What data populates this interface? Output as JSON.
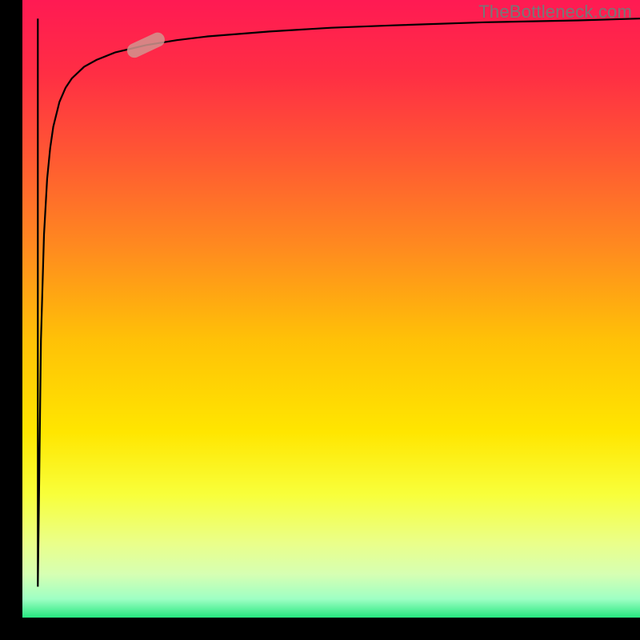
{
  "watermark": "TheBottleneck.com",
  "axes": {
    "left_border_width": 28,
    "bottom_border_height": 28
  },
  "gradient": {
    "stops": [
      {
        "offset": 0.0,
        "color": "#ff1a53"
      },
      {
        "offset": 0.12,
        "color": "#ff2e44"
      },
      {
        "offset": 0.25,
        "color": "#ff5733"
      },
      {
        "offset": 0.4,
        "color": "#ff8a1f"
      },
      {
        "offset": 0.55,
        "color": "#ffc107"
      },
      {
        "offset": 0.7,
        "color": "#ffe600"
      },
      {
        "offset": 0.8,
        "color": "#f8ff3a"
      },
      {
        "offset": 0.88,
        "color": "#eaff8a"
      },
      {
        "offset": 0.93,
        "color": "#d6ffb3"
      },
      {
        "offset": 0.97,
        "color": "#9effc4"
      },
      {
        "offset": 1.0,
        "color": "#26e87f"
      }
    ]
  },
  "chart_data": {
    "type": "line",
    "title": "",
    "xlabel": "",
    "ylabel": "",
    "xlim": [
      0,
      100
    ],
    "ylim": [
      0,
      100
    ],
    "series": [
      {
        "name": "curve",
        "x": [
          2.5,
          2.7,
          3.0,
          3.5,
          4.0,
          4.5,
          5.0,
          6.0,
          7.0,
          8.0,
          10.0,
          12.0,
          15.0,
          20.0,
          25.0,
          30.0,
          40.0,
          50.0,
          60.0,
          75.0,
          90.0,
          100.0
        ],
        "y": [
          5.0,
          20.0,
          45.0,
          62.0,
          71.0,
          76.0,
          79.5,
          83.5,
          85.8,
          87.3,
          89.2,
          90.3,
          91.5,
          92.7,
          93.5,
          94.1,
          94.9,
          95.5,
          95.9,
          96.4,
          96.7,
          97.0
        ]
      }
    ],
    "marker": {
      "x": 20.0,
      "y": 92.7,
      "angle_deg": 25,
      "color": "#d2948e"
    }
  }
}
